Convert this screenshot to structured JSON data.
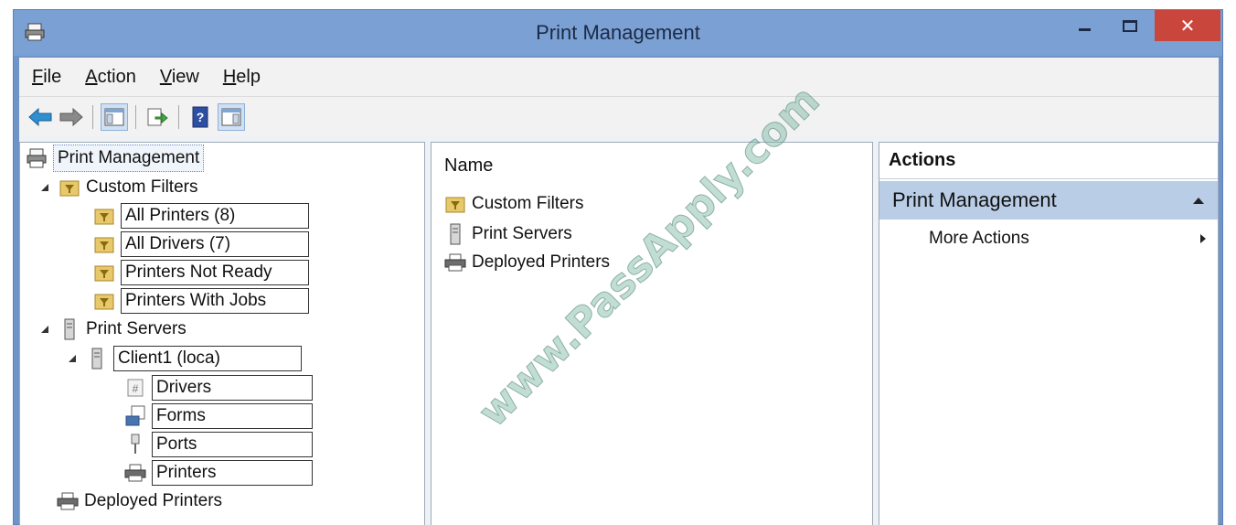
{
  "window": {
    "title": "Print Management",
    "close_glyph": "✕"
  },
  "menu": [
    "File",
    "Action",
    "View",
    "Help"
  ],
  "menu_accel": [
    "F",
    "A",
    "V",
    "H"
  ],
  "menu_rest": [
    "ile",
    "ction",
    "iew",
    "elp"
  ],
  "toolbar": {
    "icons": [
      "back-arrow-icon",
      "forward-arrow-icon",
      "show-hide-console-tree-icon",
      "export-list-icon",
      "help-icon",
      "show-hide-action-pane-icon"
    ]
  },
  "tree": {
    "root": "Print Management",
    "custom_filters": "Custom Filters",
    "filters": [
      "All Printers (8)",
      "All Drivers (7)",
      "Printers Not Ready",
      "Printers With Jobs"
    ],
    "print_servers": "Print Servers",
    "server": "Client1 (loca)",
    "server_children": [
      "Drivers",
      "Forms",
      "Ports",
      "Printers"
    ],
    "deployed": "Deployed Printers"
  },
  "list": {
    "header": "Name",
    "items": [
      "Custom Filters",
      "Print Servers",
      "Deployed Printers"
    ]
  },
  "actions": {
    "title": "Actions",
    "section": "Print Management",
    "item": "More Actions"
  },
  "watermark": "www.PassApply.com",
  "colors": {
    "titlebar": "#7ba0d4",
    "close": "#c9463d",
    "actions_section": "#b9cde6"
  }
}
